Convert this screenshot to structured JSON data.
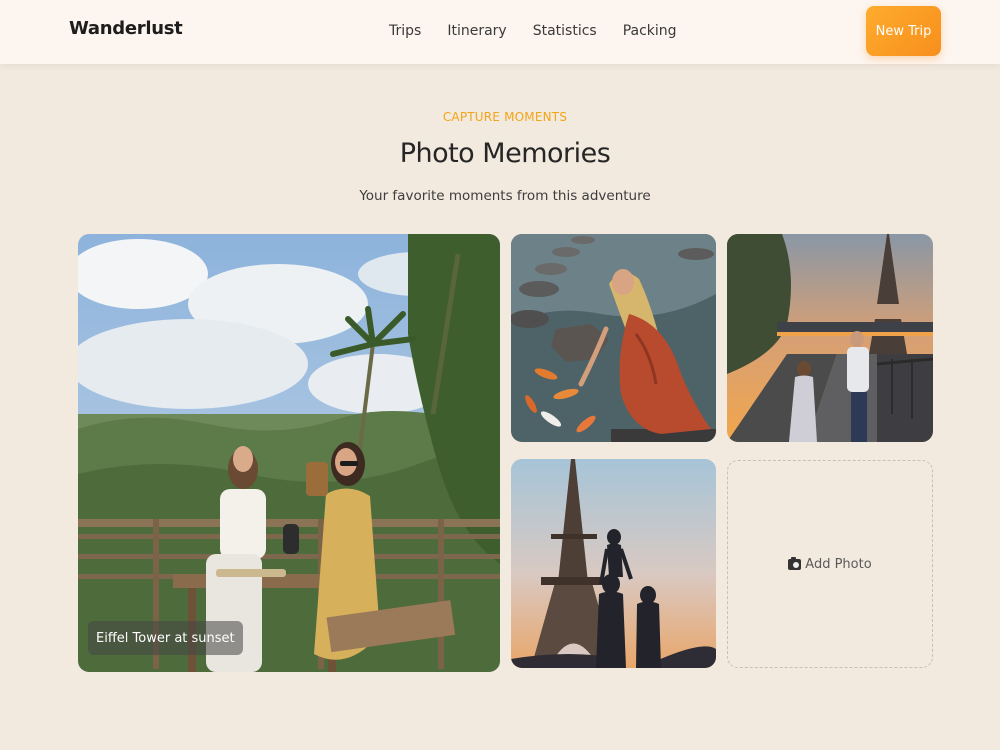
{
  "brand": "Wanderlust",
  "nav": {
    "links": [
      "Trips",
      "Itinerary",
      "Statistics",
      "Packing"
    ],
    "cta_label": "New Trip"
  },
  "section": {
    "eyebrow": "CAPTURE MOMENTS",
    "title": "Photo Memories",
    "subtitle": "Your favorite moments from this adventure"
  },
  "gallery": {
    "featured_caption": "Eiffel Tower at sunset",
    "add_label": "Add Photo",
    "add_icon": "camera-icon"
  },
  "colors": {
    "page_bg": "#f2e9df",
    "nav_bg": "#fdf5ef",
    "accent": "#f2a518",
    "button_gradient_start": "#ffab2e",
    "button_gradient_end": "#f68f1c"
  }
}
